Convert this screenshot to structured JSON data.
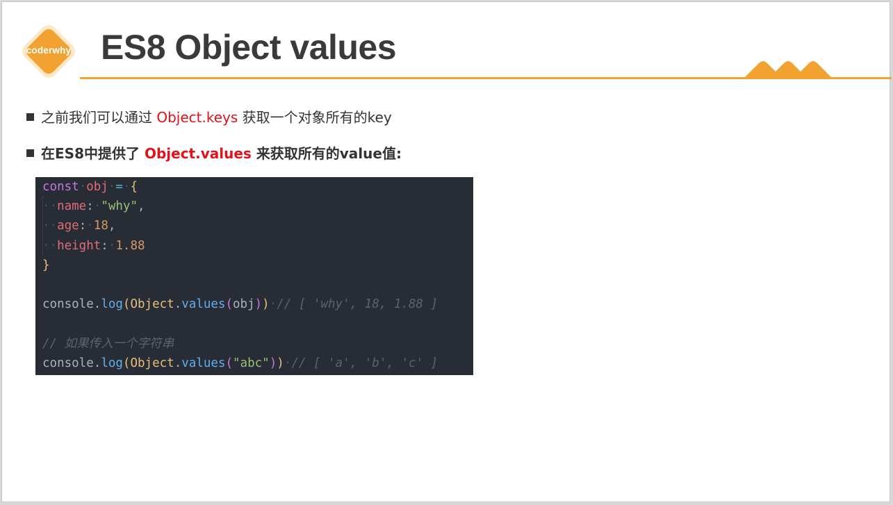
{
  "logo": {
    "text": "coderwhy",
    "color": "#f2a231"
  },
  "title": "ES8 Object values",
  "accent_color": "#f2a231",
  "bullets": [
    {
      "before": "之前我们可以通过 ",
      "highlight": "Object.keys",
      "after": " 获取一个对象所有的key"
    },
    {
      "before": "在ES8中提供了 ",
      "highlight": "Object.values",
      "after": " 来获取所有的value值:"
    }
  ],
  "code": {
    "l1": {
      "kw": "const",
      "name": "obj",
      "op": "=",
      "brace": "{"
    },
    "l2": {
      "key": "name",
      "value": "\"why\""
    },
    "l3": {
      "key": "age",
      "value": "18"
    },
    "l4": {
      "key": "height",
      "value": "1.88"
    },
    "l5": {
      "brace": "}"
    },
    "l7": {
      "obj": "console",
      "fn": "log",
      "cls": "Object",
      "method": "values",
      "arg": "obj",
      "comment": "// [ 'why', 18, 1.88 ]"
    },
    "l9": {
      "comment": "// 如果传入一个字符串"
    },
    "l10": {
      "obj": "console",
      "fn": "log",
      "cls": "Object",
      "method": "values",
      "arg": "\"abc\"",
      "comment": "// [ 'a', 'b', 'c' ]"
    }
  }
}
